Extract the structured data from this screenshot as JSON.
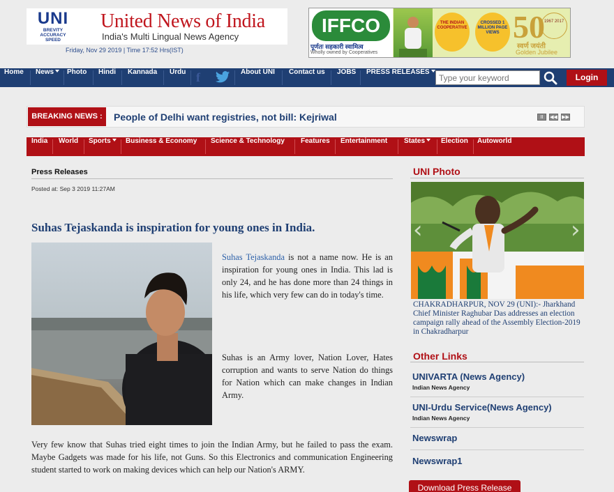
{
  "header": {
    "logo_big": "UNI",
    "logo_lines": [
      "BREVITY",
      "ACCURACY",
      "SPEED"
    ],
    "site_title": "United News of India",
    "site_subtitle": "India's Multi Lingual News Agency",
    "date_line": "Friday, Nov 29 2019 | Time 17:52 Hrs(IST)"
  },
  "ad": {
    "brand": "IFFCO",
    "hindi": "पूर्णतः सहकारी स्वामित्व",
    "owned": "Wholly owned by Cooperatives",
    "badge1": "THE INDIAN COOPERATIVE",
    "badge2": "CROSSED 1 MILLION PAGE VIEWS",
    "fifty": "50",
    "years": "1967 2017",
    "jayanti": "स्वर्ण जयंती",
    "golden": "Golden Jubilee"
  },
  "topnav": {
    "items": [
      "Home",
      "News",
      "Photo",
      "Hindi",
      "Kannada",
      "Urdu",
      "About UNI",
      "Contact us",
      "JOBS",
      "PRESS RELEASES"
    ],
    "search_placeholder": "Type your keyword",
    "login": "Login",
    "icons": [
      "facebook-icon",
      "twitter-icon",
      "search-icon"
    ]
  },
  "breaking": {
    "label": "BREAKING NEWS :",
    "headline": "People of Delhi want registries, not bill: Kejriwal",
    "controls": [
      "II",
      "◀◀",
      "▶▶"
    ]
  },
  "secnav": {
    "items": [
      "India",
      "World",
      "Sports",
      "Business & Economy",
      "Science & Technology",
      "Features",
      "Entertainment",
      "States",
      "Election",
      "Autoworld"
    ]
  },
  "article": {
    "section": "Press Releases",
    "posted": "Posted at: Sep 3 2019 11:27AM",
    "headline": "Suhas Tejaskanda is inspiration for young ones in India.",
    "p1_link": "Suhas Tejaskanda",
    "p1_rest": " is not a name now. He is an inspiration for young ones in India. This lad is only 24, and he has done more than 24 things in his life, which very few can do in today's time.",
    "p2": "Suhas is an Army lover, Nation Lover, Hates corruption and wants to serve Nation do things for Nation which can make changes in Indian Army.",
    "p3": "Very few know that Suhas tried eight times to join the Indian Army, but he failed to pass the exam. Maybe Gadgets was made for his life, not Guns. So this Electronics and communication Engineering student started to work on making devices which can help our Nation's ARMY."
  },
  "sidebar": {
    "photo_title": "UNI Photo",
    "caption": "CHAKRADHARPUR, NOV 29 (UNI):- Jharkhand Chief Minister Raghubar Das addresses an election campaign rally ahead of the Assembly Election-2019 in Chakradharpur",
    "other_title": "Other Links",
    "links": [
      {
        "name": "UNIVARTA (News Agency)",
        "sub": "Indian News Agency"
      },
      {
        "name": "UNI-Urdu Service(News Agency)",
        "sub": "Indian News Agency"
      },
      {
        "name": "Newswrap",
        "sub": ""
      },
      {
        "name": "Newswrap1",
        "sub": ""
      }
    ],
    "download": "Download Press Release"
  },
  "colors": {
    "nav_blue": "#1f3f73",
    "brand_red": "#b01016"
  }
}
